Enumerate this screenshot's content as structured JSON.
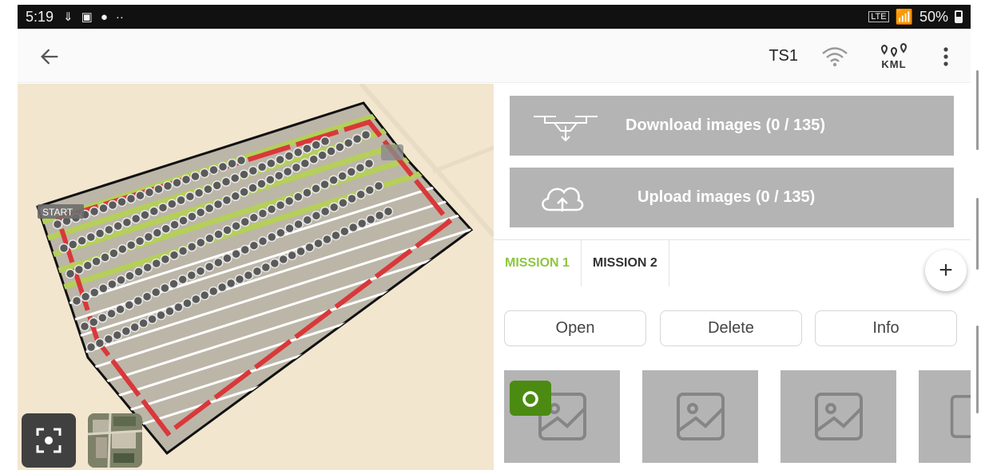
{
  "status_bar": {
    "time": "5:19",
    "network_label": "Vo)\nLTE",
    "battery_text": "50%"
  },
  "toolbar": {
    "device_name": "TS1",
    "kml_label": "KML"
  },
  "map": {
    "start_label": "START",
    "colors": {
      "field": "#bcb6a8",
      "boundary": "#111111",
      "path": "#d9383a",
      "lines": "#ffffff",
      "waypoint": "#5a5a5a",
      "green": "#b5cf5a"
    }
  },
  "panel": {
    "download_label": "Download images (0 / 135)",
    "upload_label": "Upload images (0 / 135)",
    "tabs": [
      {
        "label": "MISSION 1",
        "active": true
      },
      {
        "label": "MISSION 2",
        "active": false
      }
    ],
    "add_label": "+",
    "actions": {
      "open": "Open",
      "delete": "Delete",
      "info": "Info"
    },
    "accent_color": "#8dc63f"
  }
}
